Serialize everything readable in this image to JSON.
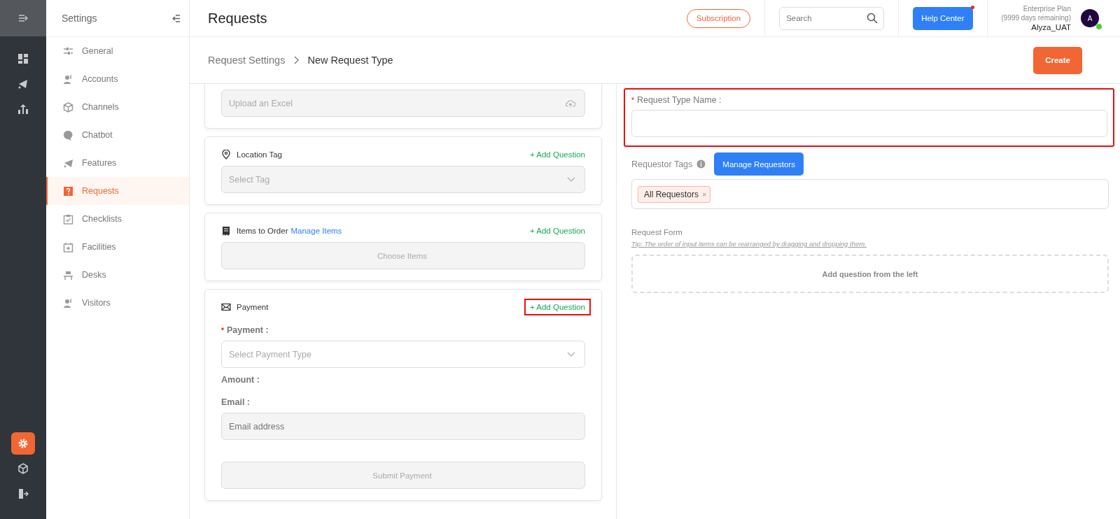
{
  "rail": {
    "top": [
      {
        "selected": false
      },
      {
        "selected": false
      },
      {
        "selected": false
      }
    ],
    "bottom": [
      {
        "selected": true
      },
      {
        "selected": false
      },
      {
        "selected": false
      }
    ]
  },
  "sidebar": {
    "title": "Settings",
    "items": [
      {
        "label": "General",
        "selected": false
      },
      {
        "label": "Accounts",
        "selected": false
      },
      {
        "label": "Channels",
        "selected": false
      },
      {
        "label": "Chatbot",
        "selected": false
      },
      {
        "label": "Features",
        "selected": false
      },
      {
        "label": "Requests",
        "selected": true
      },
      {
        "label": "Checklists",
        "selected": false
      },
      {
        "label": "Facilities",
        "selected": false
      },
      {
        "label": "Desks",
        "selected": false
      },
      {
        "label": "Visitors",
        "selected": false
      }
    ]
  },
  "header": {
    "title": "Requests",
    "subscription": "Subscription",
    "search": {
      "placeholder": "Search"
    },
    "help": "Help Center",
    "help_dot": true,
    "plan": "Enterprise Plan",
    "days": "(9999 days remaining)",
    "user": "Alyza_UAT",
    "avatar": "A",
    "online": true
  },
  "breadcrumb": [
    "Request Settings",
    "New Request Type"
  ],
  "create": "Create",
  "cards": [
    {
      "kind": "upload",
      "cut": true,
      "field": "Upload an Excel"
    },
    {
      "kind": "select",
      "title": "Location Tag",
      "add": "+ Add Question",
      "highlighted": false,
      "field": "Select Tag"
    },
    {
      "kind": "items",
      "title": "Items to Order",
      "link": "Manage Items",
      "add": "+ Add Question",
      "highlighted": false,
      "field": "Choose Items"
    },
    {
      "kind": "payment",
      "title": "Payment",
      "add": "+ Add Question",
      "highlighted": true,
      "payment_label": "Payment :",
      "payment_required": "*",
      "payment_placeholder": "Select Payment Type",
      "amount_label": "Amount :",
      "email_label": "Email :",
      "email_placeholder": "Email address",
      "submit": "Submit Payment"
    }
  ],
  "right": {
    "name_label": "Request Type Name :",
    "name_required": "*",
    "name_highlighted": true,
    "tags_label": "Requestor Tags",
    "manage": "Manage Requestors",
    "tags": [
      "All Requestors"
    ],
    "tag_remove": "×",
    "form_label": "Request Form",
    "tip": "Tip: The order of input items can be rearranged by dragging and dropping them.",
    "drop": "Add question from the left"
  }
}
